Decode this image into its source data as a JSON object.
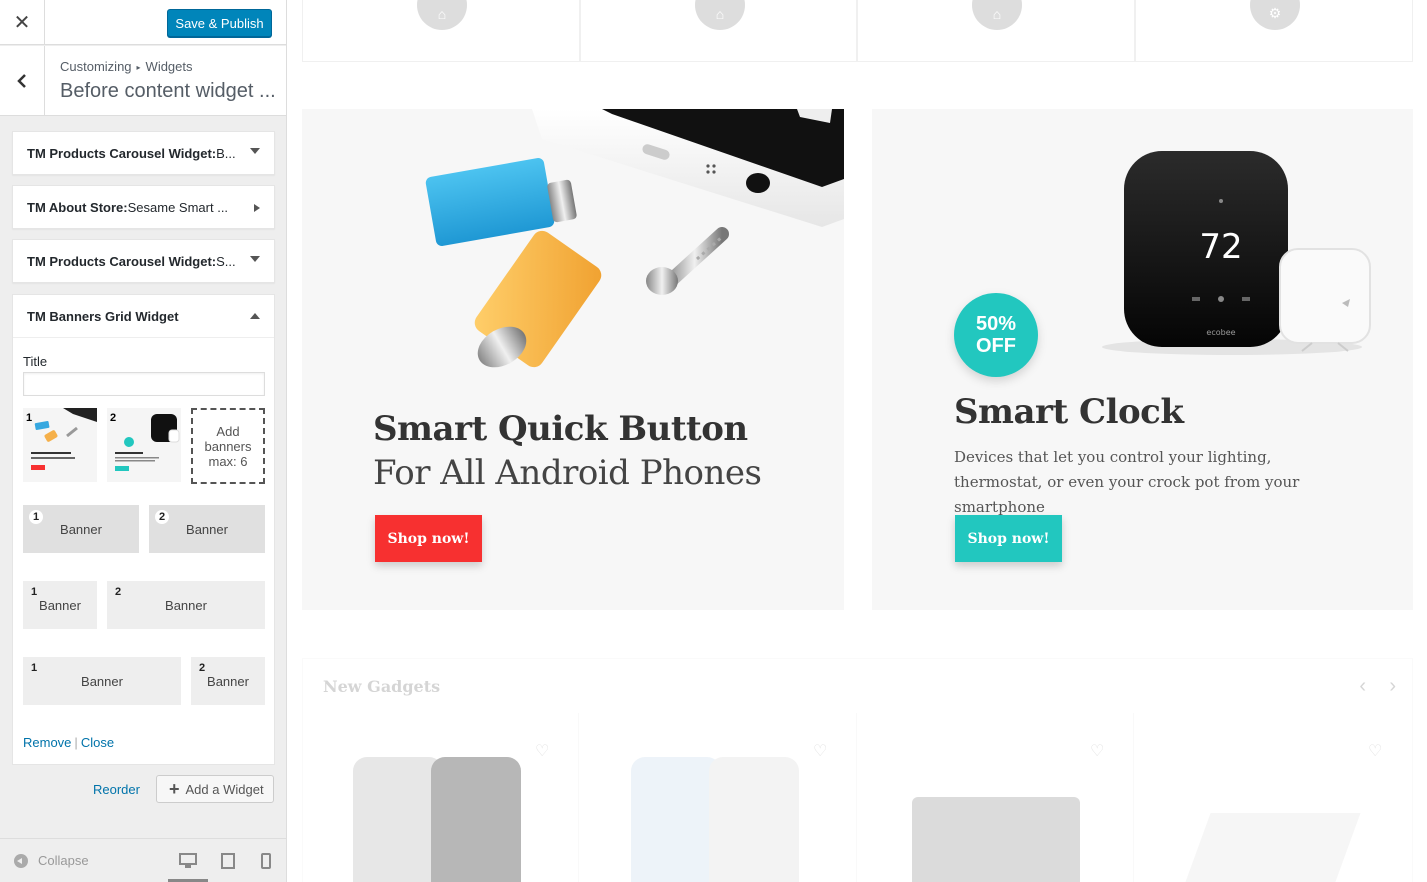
{
  "customizer": {
    "close_glyph": "✕",
    "save_publish": "Save & Publish",
    "breadcrumb": {
      "root": "Customizing",
      "section": "Widgets"
    },
    "section_title": "Before content widget ...",
    "widgets": [
      {
        "title": "TM Products Carousel Widget:",
        "subtitle": " B...",
        "state": "collapsed"
      },
      {
        "title": "TM About Store:",
        "subtitle": " Sesame Smart ...",
        "state": "collapsed-right"
      },
      {
        "title": "TM Products Carousel Widget:",
        "subtitle": " S...",
        "state": "collapsed"
      },
      {
        "title": "TM Banners Grid Widget",
        "subtitle": "",
        "state": "expanded"
      }
    ],
    "banners_grid": {
      "title_label": "Title",
      "title_value": "",
      "thumbnails": [
        {
          "num": "1",
          "caption": "Smart Quick Button For All Android Phones"
        },
        {
          "num": "2",
          "caption": "Smart Clock"
        }
      ],
      "add_banners": "Add banners max: 6",
      "layouts": [
        [
          {
            "num": "1",
            "label": "Banner"
          },
          {
            "num": "2",
            "label": "Banner"
          }
        ],
        [
          {
            "num": "1",
            "label": "Banner"
          },
          {
            "num": "2",
            "label": "Banner"
          }
        ],
        [
          {
            "num": "1",
            "label": "Banner"
          },
          {
            "num": "2",
            "label": "Banner"
          }
        ]
      ],
      "remove": "Remove",
      "separator": "|",
      "close": "Close"
    },
    "reorder": "Reorder",
    "add_widget": "Add a Widget",
    "collapse": "Collapse",
    "devices": [
      "desktop-icon",
      "tablet-icon",
      "mobile-icon"
    ]
  },
  "preview": {
    "feature_icons": [
      "basket-icon",
      "basket-icon",
      "basket-icon",
      "gear-icon"
    ],
    "banner1": {
      "title": "Smart Quick Button",
      "subtitle": "For All Android Phones",
      "button": "Shop now!",
      "button_color": "#f73030"
    },
    "banner2": {
      "badge_line1": "50%",
      "badge_line2": "OFF",
      "title": "Smart Clock",
      "description": "Devices that let you control your lighting, thermostat, or even your crock pot from your smartphone",
      "button": "Shop now!",
      "button_color": "#22c7bf",
      "thermostat_reading": "72",
      "thermostat_brand": "ecobee"
    },
    "new_gadgets": {
      "title": "New Gadgets",
      "prev": "‹",
      "next": "›"
    }
  }
}
